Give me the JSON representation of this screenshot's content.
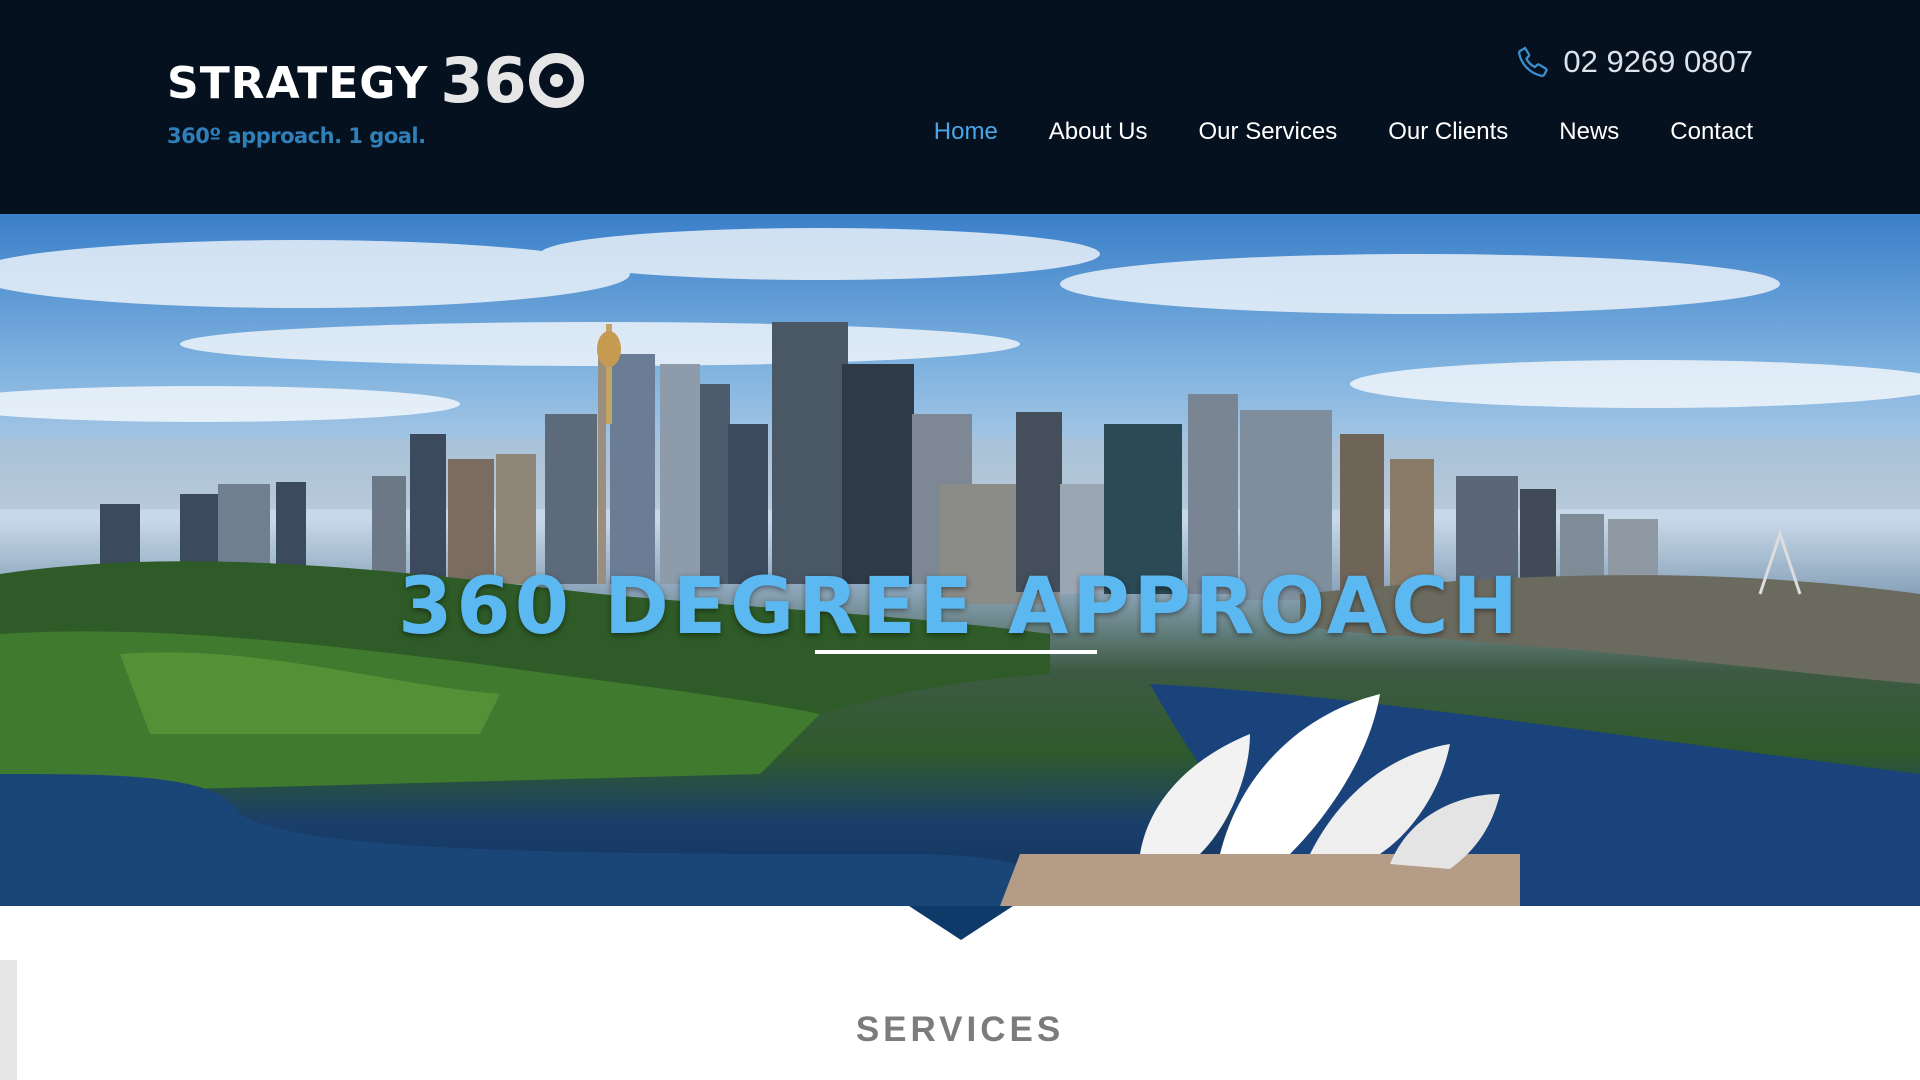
{
  "brand": {
    "name": "STRATEGY",
    "number": "36",
    "tagline": "360º approach. 1 goal."
  },
  "header": {
    "phone": "02 9269 0807",
    "phone_icon": "phone-icon"
  },
  "nav": {
    "items": [
      {
        "label": "Home",
        "active": true
      },
      {
        "label": "About Us",
        "active": false
      },
      {
        "label": "Our Services",
        "active": false
      },
      {
        "label": "Our Clients",
        "active": false
      },
      {
        "label": "News",
        "active": false
      },
      {
        "label": "Contact",
        "active": false
      }
    ]
  },
  "hero": {
    "title": "360 DEGREE APPROACH"
  },
  "services": {
    "title": "SERVICES"
  },
  "colors": {
    "header_bg": "#06111f",
    "accent": "#4aa6e6",
    "tagline": "#2f7fb8",
    "hero_title": "#5cb8f0"
  }
}
